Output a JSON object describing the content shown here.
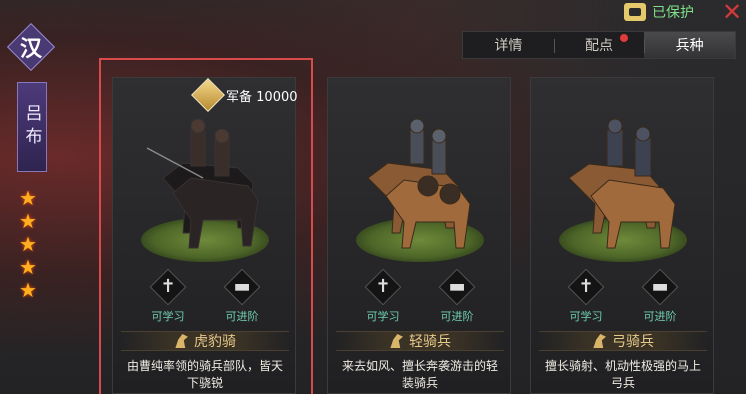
{
  "hero": {
    "faction": "汉",
    "name": "吕布",
    "stars": 5
  },
  "topbar": {
    "protect_label": "已保护",
    "close_icon": "close-icon"
  },
  "tabs": [
    {
      "label": "详情",
      "active": false
    },
    {
      "label": "配点",
      "active": false,
      "has_alert": true
    },
    {
      "label": "兵种",
      "active": true
    }
  ],
  "supply": {
    "label": "军备",
    "value": "10000"
  },
  "cards": [
    {
      "name": "虎豹骑",
      "skill_learn": "可学习",
      "skill_advance": "可进阶",
      "desc": "由曹纯率领的骑兵部队，皆天下骁锐",
      "selected": true
    },
    {
      "name": "轻骑兵",
      "skill_learn": "可学习",
      "skill_advance": "可进阶",
      "desc": "来去如风、擅长奔袭游击的轻装骑兵",
      "selected": false
    },
    {
      "name": "弓骑兵",
      "skill_learn": "可学习",
      "skill_advance": "可进阶",
      "desc": "擅长骑射、机动性极强的马上弓兵",
      "selected": false
    }
  ],
  "colors": {
    "accent_red": "#d94a4a",
    "protect_green": "#7fe08a",
    "skill_teal": "#6fd0b0",
    "unit_gold": "#e7c98a"
  }
}
